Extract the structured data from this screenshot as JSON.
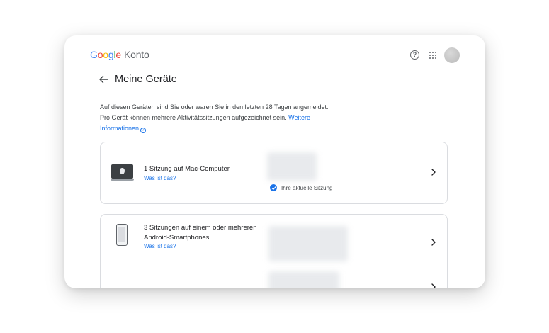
{
  "header": {
    "logo_letters": [
      "G",
      "o",
      "o",
      "g",
      "l",
      "e"
    ],
    "product": "Konto",
    "help_icon": "help-circle-icon",
    "apps_icon": "apps-grid-icon",
    "help_glyph": "?"
  },
  "page": {
    "title": "Meine Geräte",
    "back_icon": "arrow-back-icon"
  },
  "description": {
    "text": "Auf diesen Geräten sind Sie oder waren Sie in den letzten 28 Tagen angemeldet. Pro Gerät können mehrere Aktivitätssitzungen aufgezeichnet sein.",
    "link": "Weitere Informationen",
    "info_glyph": "?"
  },
  "devices": [
    {
      "title": "1 Sitzung auf Mac-Computer",
      "link": "Was ist das?",
      "status": "Ihre aktuelle Sitzung",
      "icon": "laptop-icon"
    },
    {
      "title": "3 Sitzungen auf einem oder mehreren Android-Smartphones",
      "link": "Was ist das?",
      "icon": "smartphone-icon"
    }
  ],
  "colors": {
    "link": "#1a73e8",
    "google_blue": "#4285F4",
    "google_red": "#EA4335",
    "google_yellow": "#FBBC05",
    "google_green": "#34A853"
  }
}
